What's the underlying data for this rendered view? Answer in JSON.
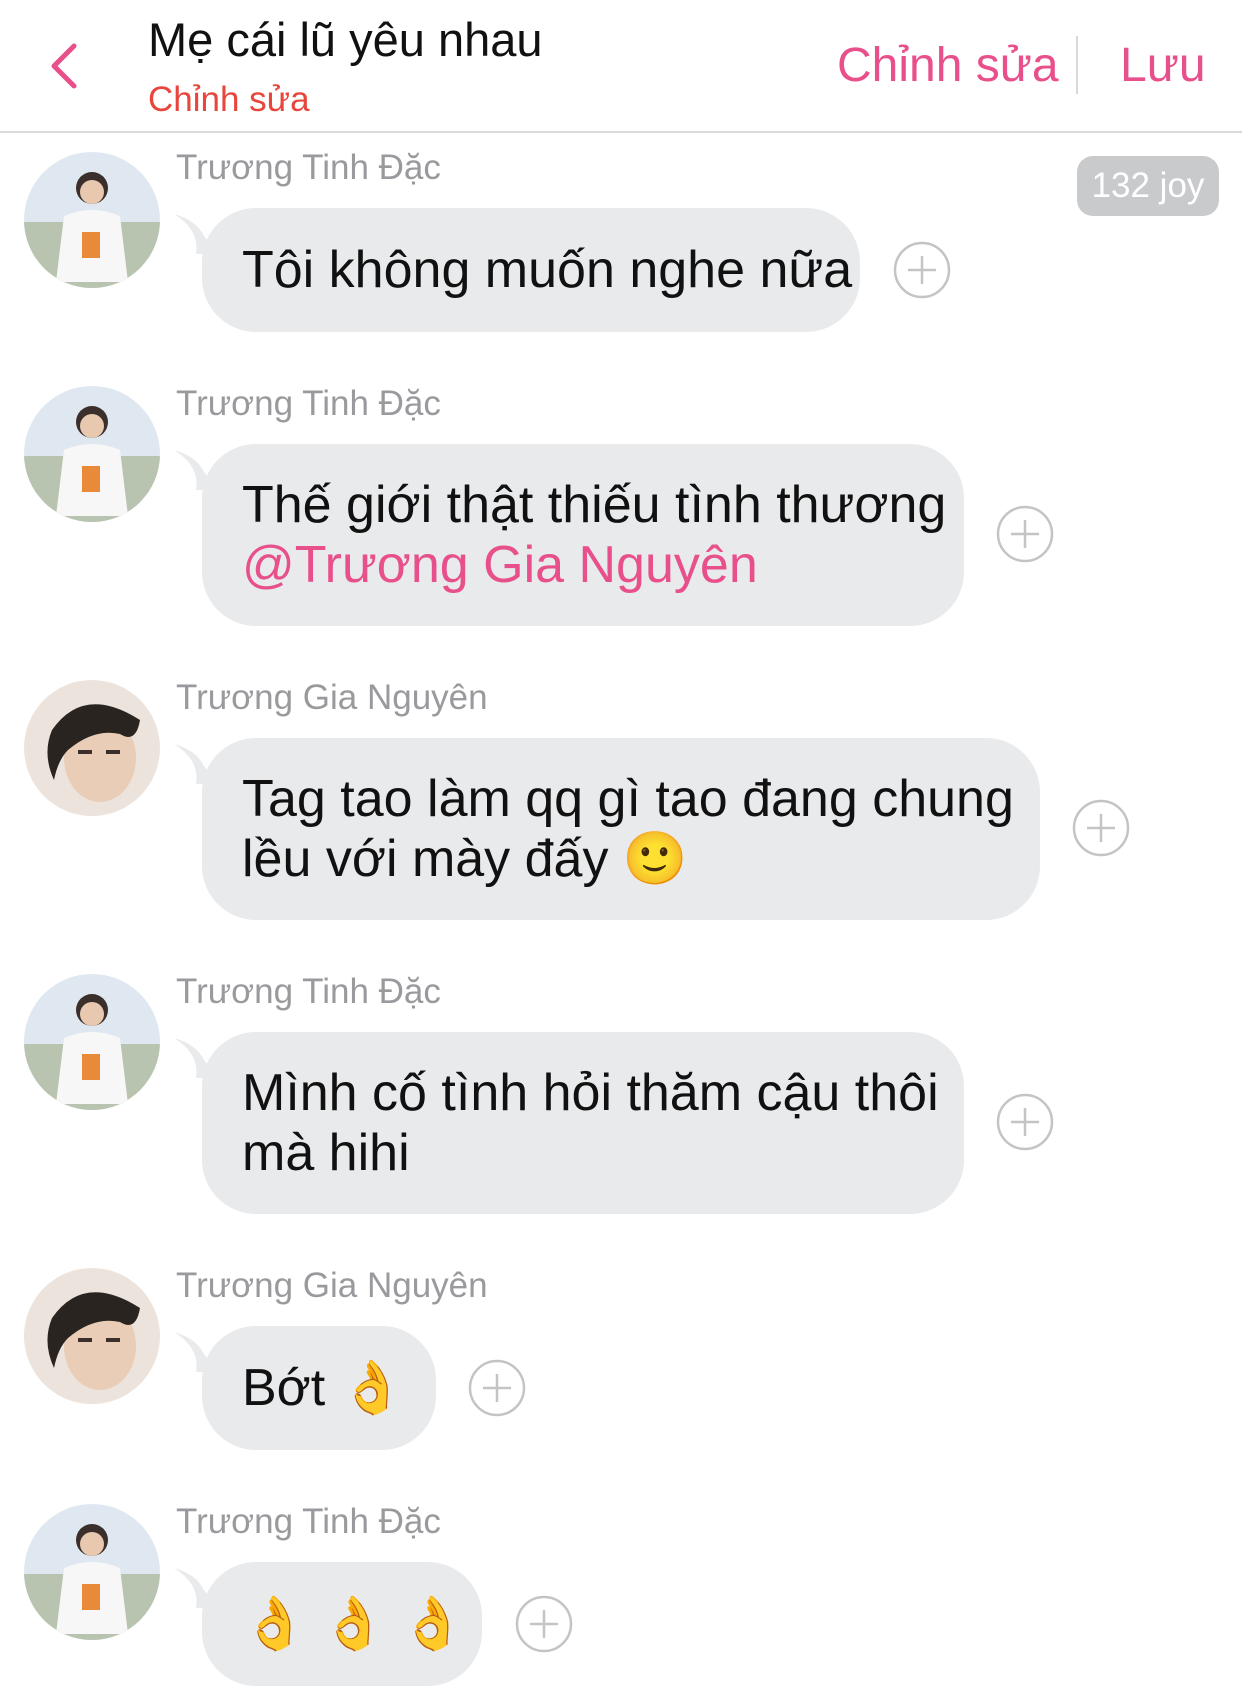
{
  "header": {
    "title": "Mẹ cái lũ yêu nhau",
    "subtitle": "Chỉnh sửa",
    "edit_label": "Chỉnh sửa",
    "save_label": "Lưu",
    "accent_color": "#e8508b",
    "back_icon": "chevron-left-icon"
  },
  "badge": {
    "label": "132 joy"
  },
  "messages": [
    {
      "sender": "Trương Tinh Đặc",
      "lines": [
        "Tôi không muốn nghe nữa"
      ],
      "mention": ""
    },
    {
      "sender": "Trương Tinh Đặc",
      "lines": [
        "Thế giới thật thiếu tình thương"
      ],
      "mention": "@Trương Gia Nguyên"
    },
    {
      "sender": "Trương Gia Nguyên",
      "lines": [
        "Tag tao làm qq gì tao đang chung",
        "lều với mày đấy 🙂"
      ],
      "mention": ""
    },
    {
      "sender": "Trương Tinh Đặc",
      "lines": [
        "Mình cố tình hỏi thăm cậu thôi",
        "mà hihi"
      ],
      "mention": ""
    },
    {
      "sender": "Trương Gia Nguyên",
      "lines": [
        "Bớt 👌"
      ],
      "mention": ""
    },
    {
      "sender": "Trương Tinh Đặc",
      "lines": [
        "👌 👌 👌"
      ],
      "mention": ""
    }
  ]
}
